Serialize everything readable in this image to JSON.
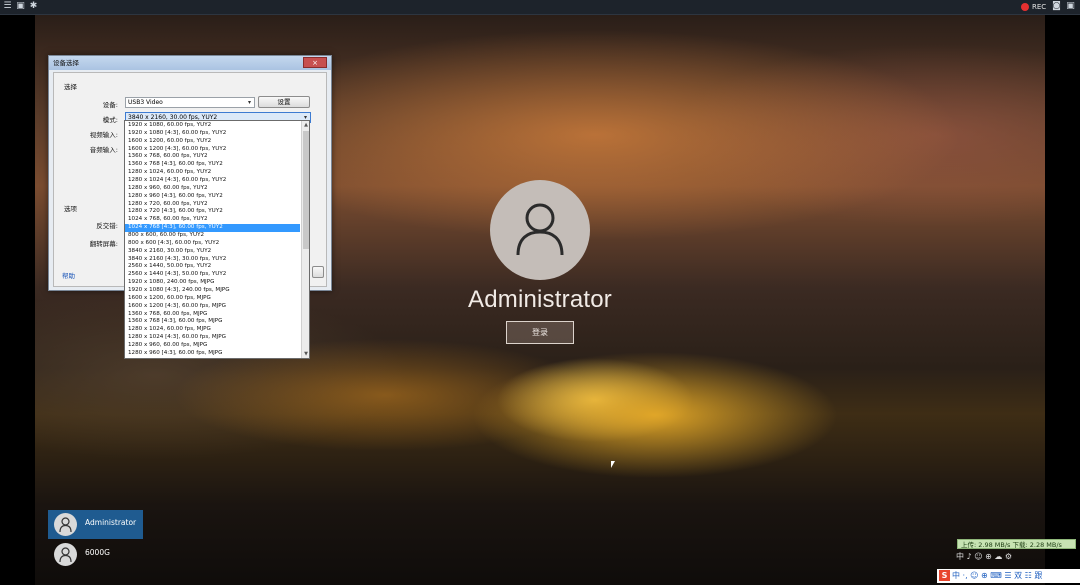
{
  "toolbar": {
    "icons": [
      "menu-icon",
      "window-icon",
      "settings-icon"
    ],
    "rec_label": "REC",
    "right_icons": [
      "camera-icon",
      "window-icon"
    ]
  },
  "lockscreen": {
    "username": "Administrator",
    "login_button": "登录",
    "users": [
      {
        "name": "Administrator",
        "active": true
      },
      {
        "name": "6000G",
        "active": false
      }
    ]
  },
  "tray": {
    "netmeter": "上传: 2.98 MB/s   下载: 2.28 MB/s",
    "tray_icons": "中 ♪ ☺ ⊕ ☁ ⚙",
    "ime_logo": "S",
    "ime_text": "中 ·, ☺ ⊕ ⌨ ☰ 双 ☷ 跟"
  },
  "dialog": {
    "title": "设备选择",
    "close_label": "×",
    "group_select": "选择",
    "device_label": "设备:",
    "device_value": "USB3 Video",
    "settings_button": "设置",
    "mode_label": "模式:",
    "mode_value": "3840 x 2160, 30.00 fps, YUY2",
    "video_input_label": "视频输入:",
    "audio_input_label": "音频输入:",
    "group_options": "选项",
    "deinterlace_label": "反交错:",
    "flip_label": "翻转屏幕:",
    "help_link": "帮助"
  },
  "mode_list": {
    "selected_index": 13,
    "items": [
      "1920 x 1080, 60.00 fps, YUY2",
      "1920 x 1080 [4:3], 60.00 fps, YUY2",
      "1600 x 1200, 60.00 fps, YUY2",
      "1600 x 1200 [4:3], 60.00 fps, YUY2",
      "1360 x 768, 60.00 fps, YUY2",
      "1360 x 768 [4:3], 60.00 fps, YUY2",
      "1280 x 1024, 60.00 fps, YUY2",
      "1280 x 1024 [4:3], 60.00 fps, YUY2",
      "1280 x 960, 60.00 fps, YUY2",
      "1280 x 960 [4:3], 60.00 fps, YUY2",
      "1280 x 720, 60.00 fps, YUY2",
      "1280 x 720 [4:3], 60.00 fps, YUY2",
      "1024 x 768, 60.00 fps, YUY2",
      "1024 x 768 [4:3], 60.00 fps, YUY2",
      "800 x 600, 60.00 fps, YUY2",
      "800 x 600 [4:3], 60.00 fps, YUY2",
      "3840 x 2160, 30.00 fps, YUY2",
      "3840 x 2160 [4:3], 30.00 fps, YUY2",
      "2560 x 1440, 50.00 fps, YUY2",
      "2560 x 1440 [4:3], 50.00 fps, YUY2",
      "1920 x 1080, 240.00 fps, MJPG",
      "1920 x 1080 [4:3], 240.00 fps, MJPG",
      "1600 x 1200, 60.00 fps, MJPG",
      "1600 x 1200 [4:3], 60.00 fps, MJPG",
      "1360 x 768, 60.00 fps, MJPG",
      "1360 x 768 [4:3], 60.00 fps, MJPG",
      "1280 x 1024, 60.00 fps, MJPG",
      "1280 x 1024 [4:3], 60.00 fps, MJPG",
      "1280 x 960, 60.00 fps, MJPG",
      "1280 x 960 [4:3], 60.00 fps, MJPG"
    ]
  }
}
